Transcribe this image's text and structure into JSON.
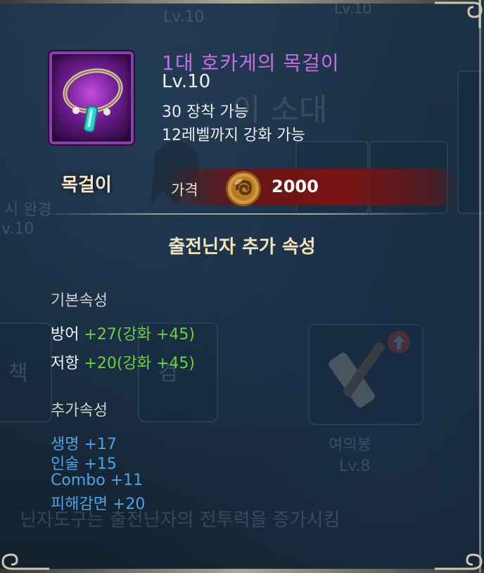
{
  "item": {
    "name": "1대 호카게의 목걸이",
    "level": "Lv.10",
    "requirement": "30 장착 가능",
    "enhance_limit": "12레벨까지 강화 가능",
    "type": "목걸이",
    "icon": "necklace-icon"
  },
  "price": {
    "label": "가격",
    "value": "2000",
    "currency_icon": "coin-icon"
  },
  "section_title": "출전닌자 추가 속성",
  "basic_attributes": {
    "title": "기본속성",
    "rows": [
      {
        "name": "방어",
        "value": "+27(강화 +45)"
      },
      {
        "name": "저항",
        "value": "+20(강화 +45)"
      }
    ]
  },
  "extra_attributes": {
    "title": "추가속성",
    "lines": [
      "생명 +17",
      "인술 +15",
      "Combo +11",
      "피해감면 +20"
    ]
  },
  "background": {
    "ghost_lv_top": "Lv.10",
    "ghost_lv_top2": "Lv.10",
    "ghost_title": "이 소대",
    "ghost_left1": "시 완경",
    "ghost_left2": "v.10",
    "ghost_tile1": "책",
    "ghost_tile2": "검",
    "ghost_item_name": "여의봉",
    "ghost_item_lv": "Lv.8",
    "ghost_bottom": "닌자도구는 출전닌자의 전투력을 증가시킴"
  },
  "colors": {
    "item_name": "#c86ee3",
    "stat_value": "#6ed13c",
    "extra_attr": "#4da3e8",
    "section_title": "#f3e3b6",
    "price_bar": "#7a1414",
    "icon_frame": "#8a3fb0"
  }
}
